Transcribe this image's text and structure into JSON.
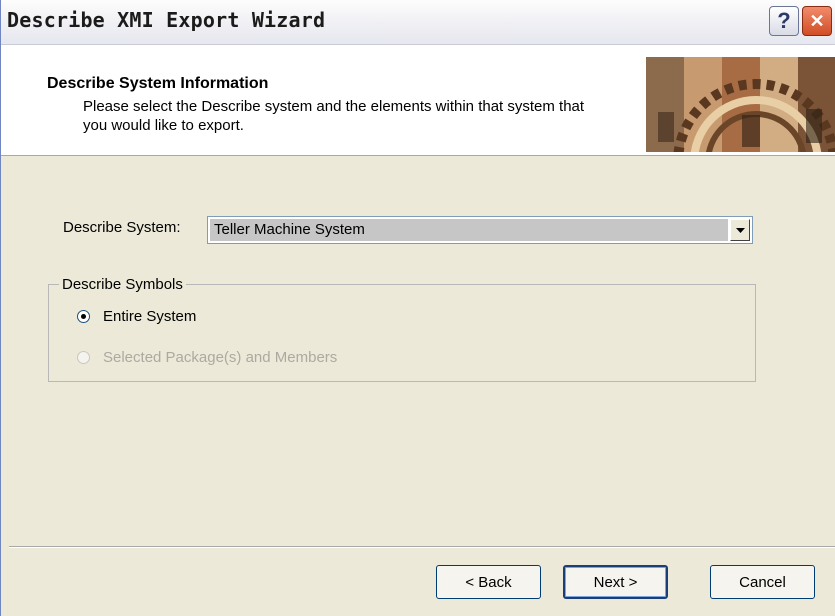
{
  "window": {
    "title": "Describe XMI Export Wizard",
    "help_glyph": "?",
    "close_glyph": "✕"
  },
  "header": {
    "title": "Describe System Information",
    "description": "Please select the Describe system and the elements within that system that you would like to export."
  },
  "system": {
    "label": "Describe System:",
    "selected": "Teller Machine System"
  },
  "symbols": {
    "legend": "Describe Symbols",
    "options": [
      {
        "label": "Entire System",
        "checked": true,
        "enabled": true
      },
      {
        "label": "Selected Package(s) and Members",
        "checked": false,
        "enabled": false
      }
    ]
  },
  "buttons": {
    "back": "< Back",
    "next": "Next >",
    "cancel": "Cancel"
  },
  "colors": {
    "window_bg": "#ece9d8",
    "header_bg": "#ffffff",
    "combo_selection": "#c6c6c6",
    "close_red": "#d14d25"
  }
}
